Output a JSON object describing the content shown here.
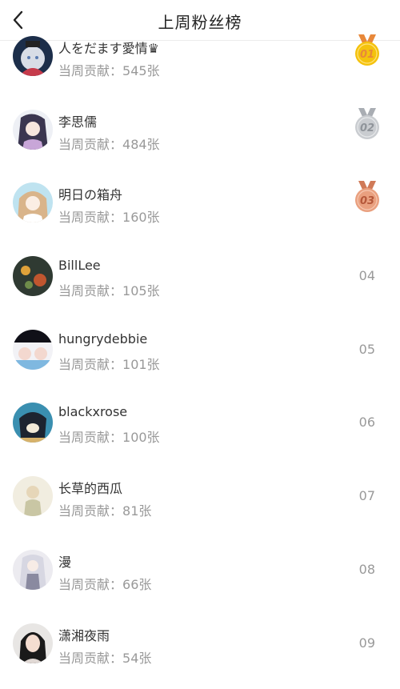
{
  "header": {
    "title": "上周粉丝榜"
  },
  "contrib_label": "当周贡献：",
  "fans": [
    {
      "name": "人をだます愛情♛",
      "count": "545张",
      "rank": "01",
      "medal": "gold"
    },
    {
      "name": "李思儒",
      "count": "484张",
      "rank": "02",
      "medal": "silver"
    },
    {
      "name": "明日の箱舟",
      "count": "160张",
      "rank": "03",
      "medal": "bronze"
    },
    {
      "name": "BillLee",
      "count": "105张",
      "rank": "04"
    },
    {
      "name": "hungrydebbie",
      "count": "101张",
      "rank": "05"
    },
    {
      "name": "blackxrose",
      "count": "100张",
      "rank": "06"
    },
    {
      "name": "长草的西瓜",
      "count": "81张",
      "rank": "07"
    },
    {
      "name": "漫",
      "count": "66张",
      "rank": "08"
    },
    {
      "name": "潇湘夜雨",
      "count": "54张",
      "rank": "09"
    }
  ],
  "colors": {
    "gold": "#f4c20d",
    "silver": "#c9ccd0",
    "bronze": "#e9a07f",
    "ribbon_gold": "#e8883a",
    "ribbon_silver": "#a9adb3",
    "ribbon_bronze": "#d07a58"
  }
}
